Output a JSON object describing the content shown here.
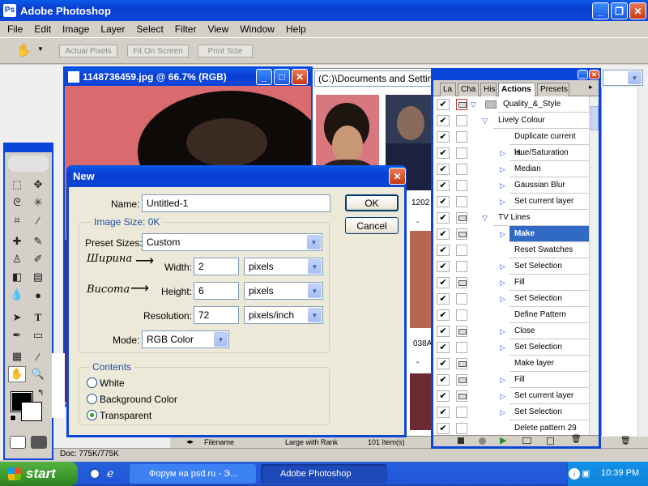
{
  "app": {
    "title": "Adobe Photoshop"
  },
  "menu": [
    "File",
    "Edit",
    "Image",
    "Layer",
    "Select",
    "Filter",
    "View",
    "Window",
    "Help"
  ],
  "options_bar": {
    "actual_pixels": "Actual Pixels",
    "fit_on_screen": "Fit On Screen",
    "print_size": "Print Size"
  },
  "document": {
    "title": "1148736459.jpg @ 66.7% (RGB)"
  },
  "file_browser": {
    "path": "(C:)\\Documents and Settin",
    "col_filename": "Filename",
    "sort": "Large with Rank",
    "items": "101 Item(s)",
    "code1": "1202",
    "code2": "038A"
  },
  "status": {
    "doc": "Doc: 775K/775K"
  },
  "dialog": {
    "title": "New",
    "name_label": "Name:",
    "name_value": "Untitled-1",
    "image_size_label": "Image Size: 0K",
    "preset_label": "Preset Sizes:",
    "preset_value": "Custom",
    "width_label": "Width:",
    "width_value": "2",
    "width_unit": "pixels",
    "height_label": "Height:",
    "height_value": "6",
    "height_unit": "pixels",
    "resolution_label": "Resolution:",
    "resolution_value": "72",
    "resolution_unit": "pixels/inch",
    "mode_label": "Mode:",
    "mode_value": "RGB Color",
    "contents_label": "Contents",
    "contents_options": [
      "White",
      "Background Color",
      "Transparent"
    ],
    "contents_selected": "Transparent",
    "ok": "OK",
    "cancel": "Cancel",
    "annotation_width": "Ширина",
    "annotation_height": "Висота"
  },
  "actions_panel": {
    "tabs": [
      "La",
      "Cha",
      "His",
      "Actions",
      "Presets"
    ],
    "active_tab": "Actions",
    "rows": [
      {
        "name": "Quality_&_Style",
        "level": 0,
        "dialog": true,
        "expanded": true
      },
      {
        "name": "Lively Colour",
        "level": 1,
        "dialog": false,
        "expanded": true
      },
      {
        "name": "Duplicate current la...",
        "level": 2,
        "dialog": false
      },
      {
        "name": "Hue/Saturation",
        "level": 2,
        "dialog": false,
        "collapsed": true
      },
      {
        "name": "Median",
        "level": 2,
        "dialog": false,
        "collapsed": true
      },
      {
        "name": "Gaussian Blur",
        "level": 2,
        "dialog": false,
        "collapsed": true
      },
      {
        "name": "Set current layer",
        "level": 2,
        "dialog": false,
        "collapsed": true
      },
      {
        "name": "TV Lines",
        "level": 1,
        "dialog": true,
        "expanded": true
      },
      {
        "name": "Make",
        "level": 2,
        "dialog": true,
        "collapsed": true,
        "selected": true
      },
      {
        "name": "Reset Swatches",
        "level": 2,
        "dialog": false
      },
      {
        "name": "Set Selection",
        "level": 2,
        "dialog": false,
        "collapsed": true
      },
      {
        "name": "Fill",
        "level": 2,
        "dialog": true,
        "collapsed": true
      },
      {
        "name": "Set Selection",
        "level": 2,
        "dialog": false,
        "collapsed": true
      },
      {
        "name": "Define Pattern",
        "level": 2,
        "dialog": false
      },
      {
        "name": "Close",
        "level": 2,
        "dialog": true,
        "collapsed": true
      },
      {
        "name": "Set Selection",
        "level": 2,
        "dialog": false,
        "collapsed": true
      },
      {
        "name": "Make layer",
        "level": 2,
        "dialog": true
      },
      {
        "name": "Fill",
        "level": 2,
        "dialog": true,
        "collapsed": true
      },
      {
        "name": "Set current layer",
        "level": 2,
        "dialog": true,
        "collapsed": true
      },
      {
        "name": "Set Selection",
        "level": 2,
        "dialog": false,
        "collapsed": true
      },
      {
        "name": "Delete pattern 29",
        "level": 2,
        "dialog": false
      }
    ]
  },
  "taskbar": {
    "start": "start",
    "items": [
      "Форум на psd.ru - Э...",
      "Adobe Photoshop"
    ],
    "active": "Adobe Photoshop",
    "clock": "10:39 PM"
  },
  "colors": {
    "xp_blue": "#0b46d8",
    "start_green": "#3c9a2e",
    "selection": "#316ac5"
  }
}
